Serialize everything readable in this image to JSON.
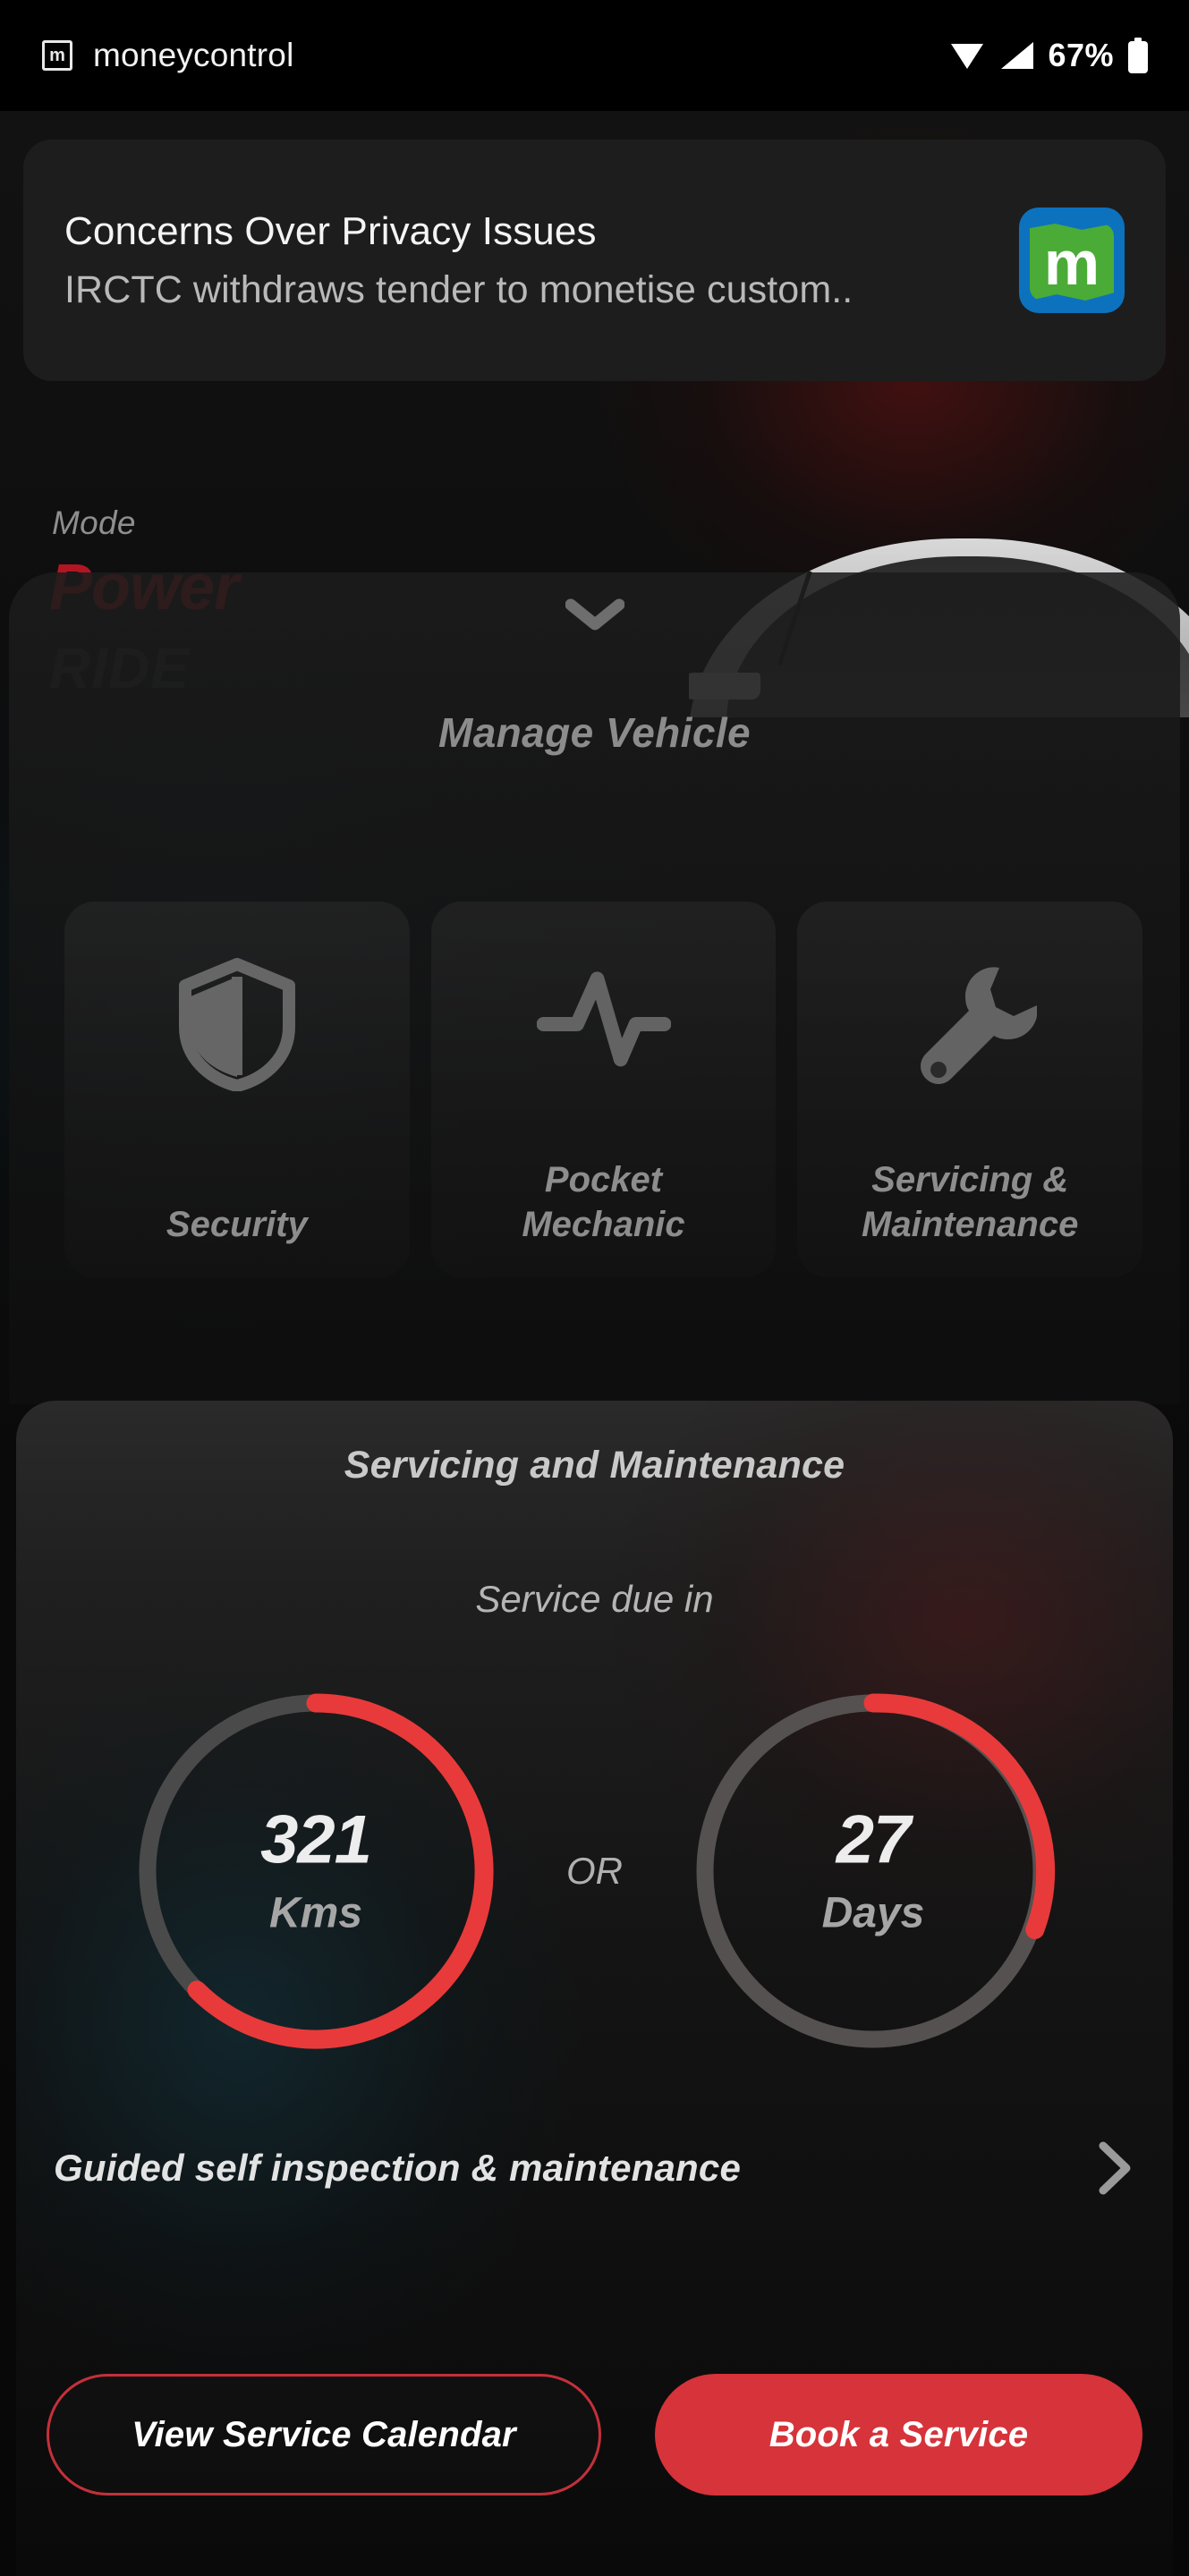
{
  "status_bar": {
    "app_icon": "moneycontrol-app-icon",
    "app_icon_letter": "m",
    "app_name": "moneycontrol",
    "wifi_icon": "wifi-icon",
    "signal_icon": "cellular-signal-icon",
    "battery_percent": "67%",
    "battery_icon": "battery-icon"
  },
  "notification": {
    "title": "Concerns Over Privacy Issues",
    "body": "IRCTC withdraws tender to monetise custom..",
    "logo_icon": "moneycontrol-logo",
    "logo_letter": "m"
  },
  "background": {
    "mode_label": "Mode",
    "mode_value": "Power",
    "mode_sub": "RIDE",
    "vehicle_image": "car-front-image"
  },
  "manage_vehicle": {
    "collapse_icon": "chevron-down-icon",
    "title": "Manage Vehicle",
    "tiles": [
      {
        "label": "Security",
        "icon": "shield-icon"
      },
      {
        "label": "Pocket\nMechanic",
        "label_line1": "Pocket",
        "label_line2": "Mechanic",
        "icon": "pulse-waveform-icon"
      },
      {
        "label": "Servicing &\nMaintenance",
        "label_line1": "Servicing &",
        "label_line2": "Maintenance",
        "icon": "wrench-icon"
      }
    ]
  },
  "servicing_sheet": {
    "title": "Servicing and Maintenance",
    "subtitle": "Service due in",
    "separator": "OR",
    "gauges": [
      {
        "value": "321",
        "unit": "Kms",
        "progress_percent": 66,
        "arc_color": "#E83A3A",
        "track_color": "#4a4a4a"
      },
      {
        "value": "27",
        "unit": "Days",
        "progress_percent": 32,
        "arc_color": "#E83A3A",
        "track_color": "#555150"
      }
    ],
    "guided_row": {
      "label": "Guided self inspection & maintenance",
      "chevron_icon": "chevron-right-icon"
    },
    "buttons": {
      "secondary": "View Service Calendar",
      "primary": "Book a Service"
    }
  },
  "colors": {
    "accent_red": "#D6333A",
    "gauge_red": "#E83A3A",
    "outline_red": "#C4303A",
    "logo_blue": "#0C72BE",
    "logo_green": "#4BAB37"
  }
}
